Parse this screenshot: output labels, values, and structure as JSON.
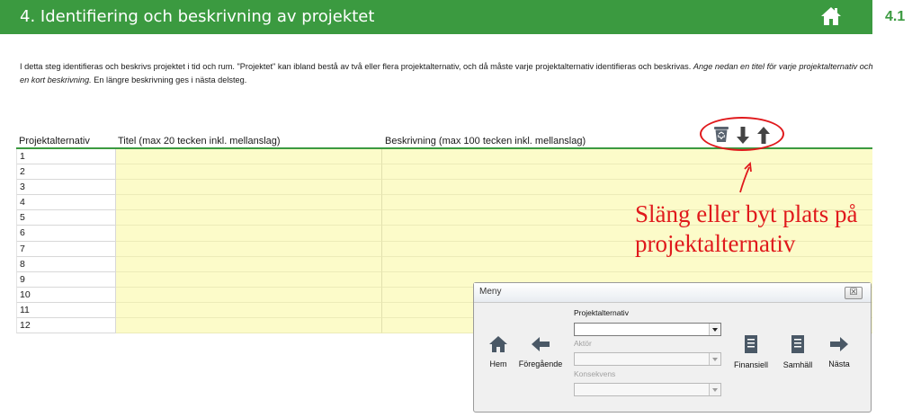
{
  "header": {
    "title": "4. Identifiering och beskrivning av projektet",
    "section_number": "4.1",
    "home_icon": "home-icon"
  },
  "intro": {
    "text": "I detta steg identifieras och beskrivs projektet i tid och rum. \"Projektet\" kan ibland bestå av två eller flera projektalternativ, och då måste varje projektalternativ identifieras och beskrivas.",
    "italic_text": "Ange nedan en titel för varje projektalternativ och en kort beskrivning.",
    "tail_text": "En längre beskrivning ges i nästa delsteg."
  },
  "table": {
    "columns": [
      "Projektalternativ",
      "Titel (max 20 tecken inkl. mellanslag)",
      "Beskrivning (max 100 tecken inkl. mellanslag)"
    ],
    "rows": [
      "1",
      "2",
      "3",
      "4",
      "5",
      "6",
      "7",
      "8",
      "9",
      "10",
      "11",
      "12"
    ]
  },
  "actions": {
    "icons": [
      "recycle-bin-icon",
      "arrow-down-icon",
      "arrow-up-icon"
    ]
  },
  "annotation": {
    "line1": "Släng eller byt plats på",
    "line2": "projektalternativ",
    "color": "#e0191c"
  },
  "menu": {
    "title": "Meny",
    "close_label": "☒",
    "fields": {
      "projektalternativ_label": "Projektalternativ",
      "aktor_label": "Aktör",
      "konsekvens_label": "Konsekvens"
    },
    "buttons": {
      "hem": "Hem",
      "foregaende": "Föregående",
      "finansiell": "Finansiell",
      "samhall": "Samhäll",
      "nasta": "Nästa"
    }
  },
  "colors": {
    "header_green": "#3b9a40",
    "cell_yellow": "#fcfbc9",
    "annotation_red": "#e0191c"
  }
}
